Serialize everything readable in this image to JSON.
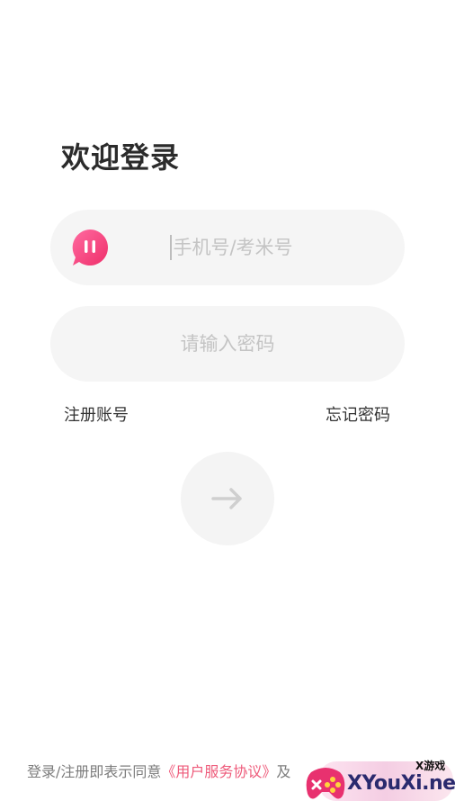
{
  "login": {
    "title": "欢迎登录",
    "phone_placeholder": "手机号/考米号",
    "password_placeholder": "请输入密码",
    "register_label": "注册账号",
    "forgot_label": "忘记密码"
  },
  "submit": {
    "icon": "arrow-right-icon"
  },
  "agreement": {
    "prefix": "登录/注册即表示同意",
    "protocol": "《用户服务协议》",
    "suffix": "及"
  },
  "watermark": {
    "sub": "X游戏",
    "main": "XYouXi.net"
  },
  "colors": {
    "accent": "#ee5a7a",
    "pill_bg": "#f5f5f5",
    "logo": "#f0407a"
  }
}
